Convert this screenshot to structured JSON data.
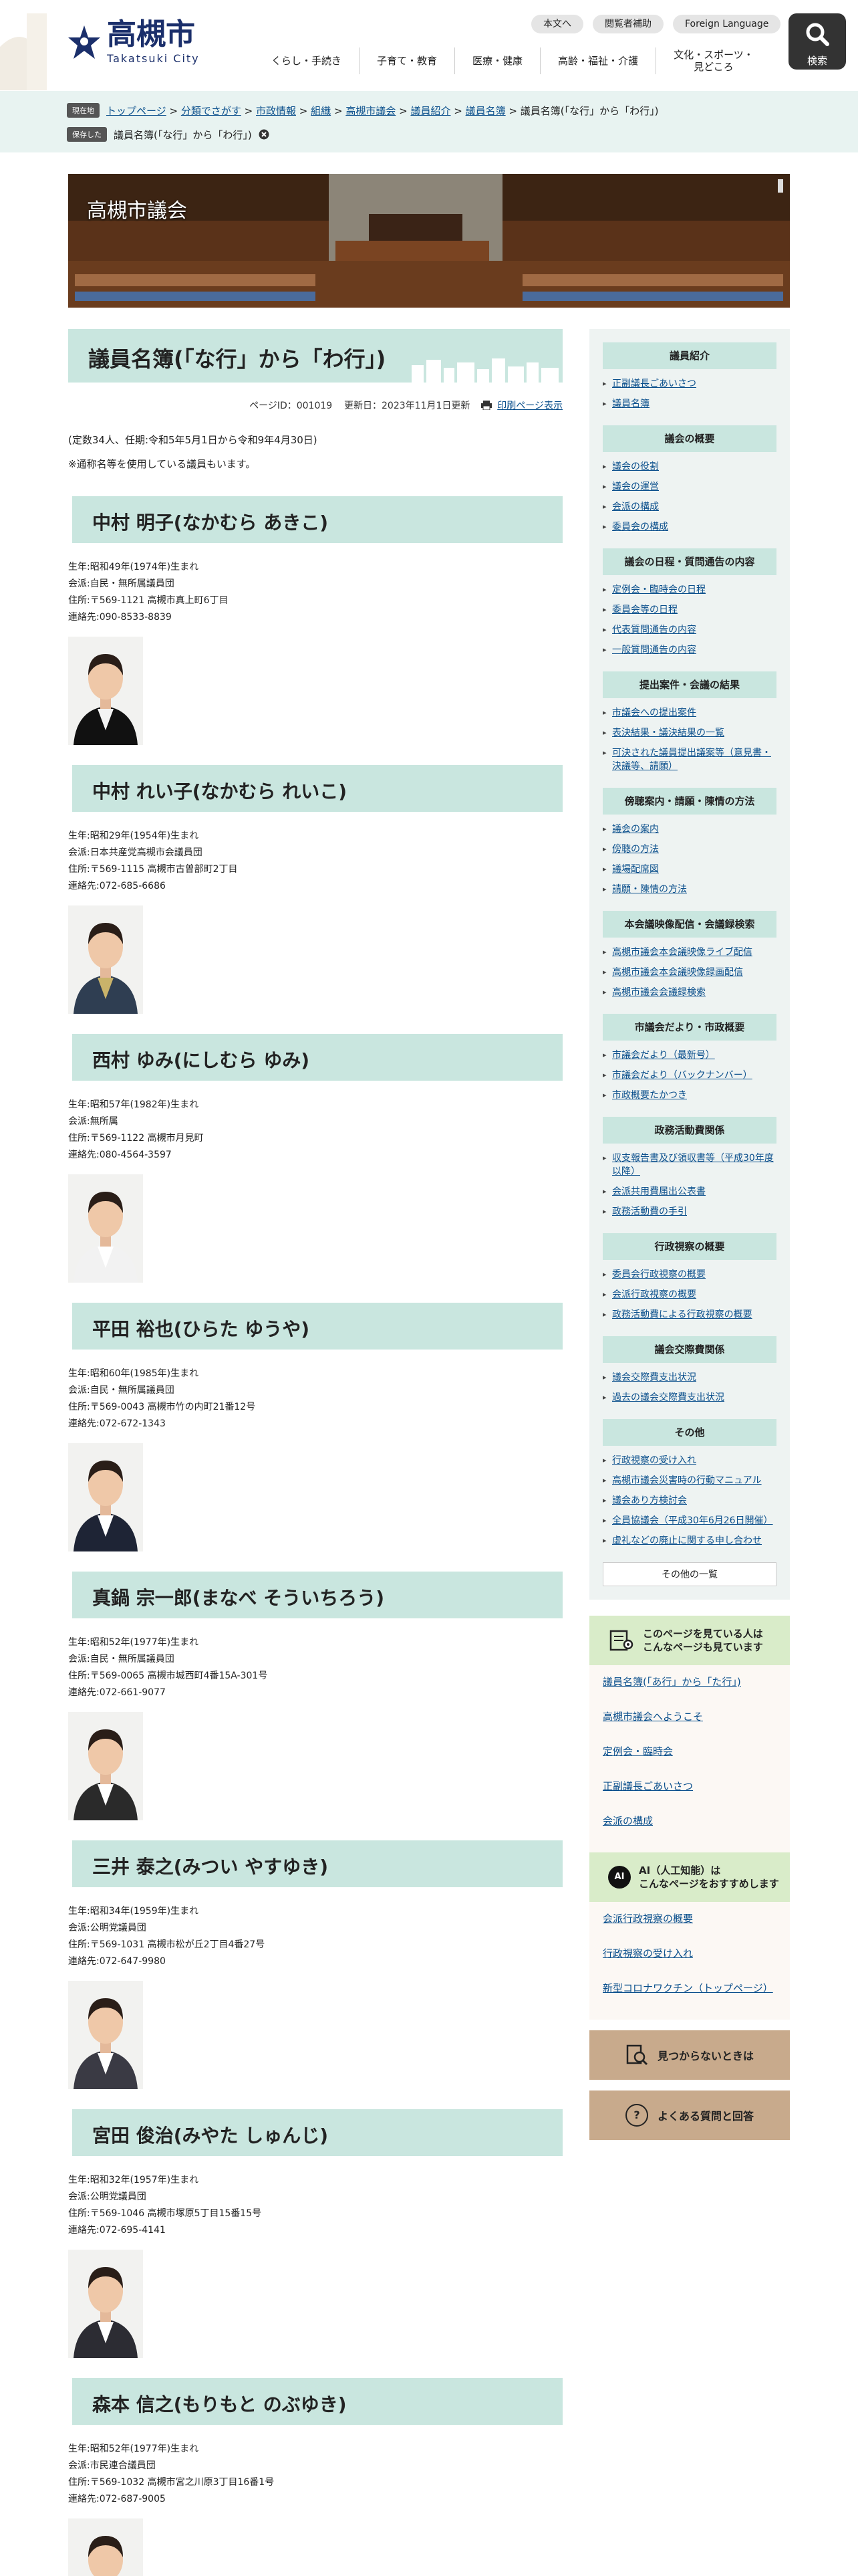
{
  "header": {
    "logo_title": "高槻市",
    "logo_sub": "Takatsuki City",
    "util_buttons": [
      "本文へ",
      "閲覧者補助",
      "Foreign Language"
    ],
    "search_label": "検索",
    "nav": [
      "くらし・手続き",
      "子育て・教育",
      "医療・健康",
      "高齢・福祉・介護",
      "文化・スポーツ・",
      "見どころ"
    ]
  },
  "breadcrumb": {
    "current_tag": "現在地",
    "items": [
      "トップページ",
      "分類でさがす",
      "市政情報",
      "組織",
      "高槻市議会",
      "議員紹介",
      "議員名簿"
    ],
    "current": "議員名簿(「な行」から「わ行」)",
    "sep": ">",
    "saved_tag": "保存した",
    "saved_label": "議員名簿(「な行」から「わ行」)"
  },
  "banner": {
    "title": "高槻市議会"
  },
  "page": {
    "title": "議員名簿(「な行」から「わ行」)",
    "page_id": "ページID：001019",
    "updated": "更新日：2023年11月1日更新",
    "print": "印刷ページ表示",
    "lead1": "(定数34人、任期:令和5年5月1日から令和9年4月30日)",
    "lead2": "※通称名等を使用している議員もいます。"
  },
  "members": [
    {
      "name": "中村 明子(なかむら あきこ)",
      "born": "生年:昭和49年(1974年)生まれ",
      "party": "会派:自民・無所属議員団",
      "addr": "住所:〒569-1121 高槻市真上町6丁目",
      "tel": "連絡先:090-8533-8839",
      "shirt": "#f4f4f4",
      "jacket": "#111"
    },
    {
      "name": "中村 れい子(なかむら れいこ)",
      "born": "生年:昭和29年(1954年)生まれ",
      "party": "会派:日本共産党高槻市会議員団",
      "addr": "住所:〒569-1115 高槻市古曽部町2丁目",
      "tel": "連絡先:072-685-6686",
      "shirt": "#c9b36a",
      "jacket": "#2f3e52"
    },
    {
      "name": "西村 ゆみ(にしむら ゆみ)",
      "born": "生年:昭和57年(1982年)生まれ",
      "party": "会派:無所属",
      "addr": "住所:〒569-1122 高槻市月見町",
      "tel": "連絡先:080-4564-3597",
      "shirt": "#fff",
      "jacket": "#f2f2f2"
    },
    {
      "name": "平田 裕也(ひらた ゆうや)",
      "born": "生年:昭和60年(1985年)生まれ",
      "party": "会派:自民・無所属議員団",
      "addr": "住所:〒569-0043 高槻市竹の内町21番12号",
      "tel": "連絡先:072-672-1343",
      "shirt": "#fff",
      "jacket": "#1e2435"
    },
    {
      "name": "真鍋 宗一郎(まなべ そういちろう)",
      "born": "生年:昭和52年(1977年)生まれ",
      "party": "会派:自民・無所属議員団",
      "addr": "住所:〒569-0065 高槻市城西町4番15A-301号",
      "tel": "連絡先:072-661-9077",
      "shirt": "#fff",
      "jacket": "#2a2a2a"
    },
    {
      "name": "三井 泰之(みつい やすゆき)",
      "born": "生年:昭和34年(1959年)生まれ",
      "party": "会派:公明党議員団",
      "addr": "住所:〒569-1031 高槻市松が丘2丁目4番27号",
      "tel": "連絡先:072-647-9980",
      "shirt": "#fff",
      "jacket": "#3a3a44"
    },
    {
      "name": "宮田 俊治(みやた しゅんじ)",
      "born": "生年:昭和32年(1957年)生まれ",
      "party": "会派:公明党議員団",
      "addr": "住所:〒569-1046 高槻市塚原5丁目15番15号",
      "tel": "連絡先:072-695-4141",
      "shirt": "#fff",
      "jacket": "#2c2c33"
    },
    {
      "name": "森本 信之(もりもと のぶゆき)",
      "born": "生年:昭和52年(1977年)生まれ",
      "party": "会派:市民連合議員団",
      "addr": "住所:〒569-1032 高槻市宮之川原3丁目16番1号",
      "tel": "連絡先:072-687-9005",
      "shirt": "#fff",
      "jacket": "#1e2435"
    }
  ],
  "sidebar": {
    "sections": [
      {
        "heading": "議員紹介",
        "links": [
          "正副議長ごあいさつ",
          "議員名簿"
        ]
      },
      {
        "heading": "議会の概要",
        "links": [
          "議会の役割",
          "議会の運営",
          "会派の構成",
          "委員会の構成"
        ]
      },
      {
        "heading": "議会の日程・質問通告の内容",
        "links": [
          "定例会・臨時会の日程",
          "委員会等の日程",
          "代表質問通告の内容",
          "一般質問通告の内容"
        ]
      },
      {
        "heading": "提出案件・会議の結果",
        "links": [
          "市議会への提出案件",
          "表決結果・議決結果の一覧",
          "可決された議員提出議案等（意見書・決議等、請願）"
        ]
      },
      {
        "heading": "傍聴案内・請願・陳情の方法",
        "links": [
          "議会の案内",
          "傍聴の方法",
          "議場配席図",
          "請願・陳情の方法"
        ]
      },
      {
        "heading": "本会議映像配信・会議録検索",
        "links": [
          "高槻市議会本会議映像ライブ配信",
          "高槻市議会本会議映像録画配信",
          "高槻市議会会議録検索"
        ]
      },
      {
        "heading": "市議会だより・市政概要",
        "links": [
          "市議会だより（最新号）",
          "市議会だより（バックナンバー）",
          "市政概要たかつき"
        ]
      },
      {
        "heading": "政務活動費関係",
        "links": [
          "収支報告書及び領収書等（平成30年度以降）",
          "会派共用費届出公表書",
          "政務活動費の手引"
        ]
      },
      {
        "heading": "行政視察の概要",
        "links": [
          "委員会行政視察の概要",
          "会派行政視察の概要",
          "政務活動費による行政視察の概要"
        ]
      },
      {
        "heading": "議会交際費関係",
        "links": [
          "議会交際費支出状況",
          "過去の議会交際費支出状況"
        ]
      },
      {
        "heading": "その他",
        "links": [
          "行政視察の受け入れ",
          "高槻市議会災害時の行動マニュアル",
          "議会あり方検討会",
          "全員協議会（平成30年6月26日開催）",
          "虚礼などの廃止に関する申し合わせ"
        ]
      }
    ],
    "more": "その他の一覧",
    "rec1_title_a": "このページを見ている人は",
    "rec1_title_b": "こんなページも見ています",
    "rec1_links": [
      "議員名簿(「あ行」から「た行」)",
      "高槻市議会へようこそ",
      "定例会・臨時会",
      "正副議長ごあいさつ",
      "会派の構成"
    ],
    "rec2_badge": "AI",
    "rec2_title_a": "AI（人工知能）は",
    "rec2_title_b": "こんなページをおすすめします",
    "rec2_links": [
      "会派行政視察の概要",
      "行政視察の受け入れ",
      "新型コロナワクチン（トップページ）"
    ],
    "btn_notfound": "見つからないときは",
    "btn_faq": "よくある質問と回答",
    "faq_mark": "?"
  },
  "colors": {
    "accent": "#c9e6df",
    "navy": "#1b2f6b",
    "link": "#0a4f8c"
  }
}
